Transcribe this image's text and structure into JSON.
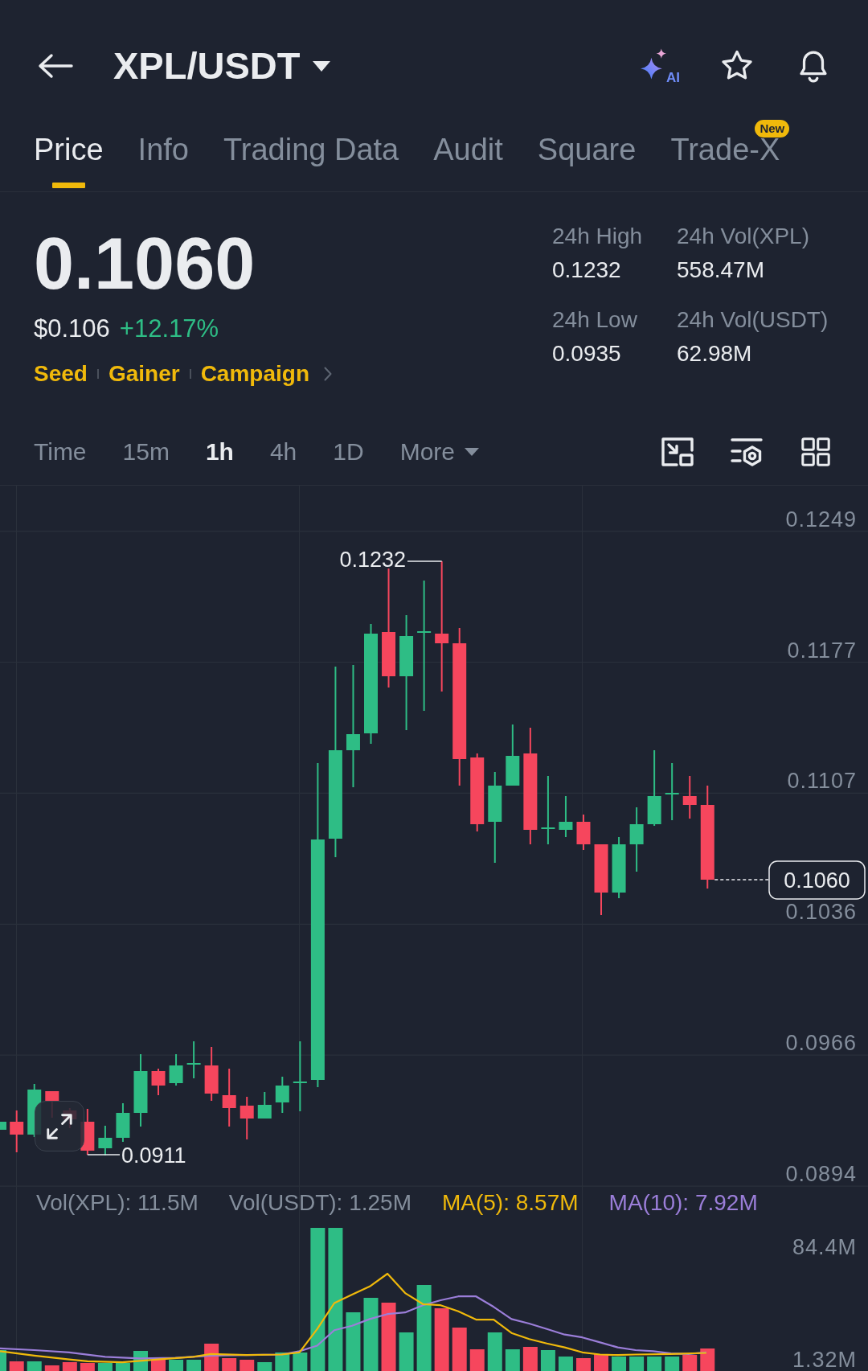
{
  "header": {
    "title": "XPL/USDT",
    "ai_label": "AI",
    "favorite": false
  },
  "tabs": [
    {
      "label": "Price",
      "selected": true
    },
    {
      "label": "Info",
      "selected": false
    },
    {
      "label": "Trading Data",
      "selected": false
    },
    {
      "label": "Audit",
      "selected": false
    },
    {
      "label": "Square",
      "selected": false
    },
    {
      "label": "Trade-X",
      "selected": false,
      "badge": "New"
    }
  ],
  "ticker": {
    "last_price": "0.1060",
    "fiat_price": "$0.106",
    "change": "+12.17%",
    "tags": [
      "Seed",
      "Gainer",
      "Campaign"
    ],
    "stats": [
      {
        "label": "24h High",
        "value": "0.1232"
      },
      {
        "label": "24h Vol(XPL)",
        "value": "558.47M"
      },
      {
        "label": "24h Low",
        "value": "0.0935"
      },
      {
        "label": "24h Vol(USDT)",
        "value": "62.98M"
      }
    ]
  },
  "intervals": [
    {
      "label": "Time",
      "selected": false,
      "kind": "option"
    },
    {
      "label": "15m",
      "selected": false,
      "kind": "option"
    },
    {
      "label": "1h",
      "selected": true,
      "kind": "option"
    },
    {
      "label": "4h",
      "selected": false,
      "kind": "option"
    },
    {
      "label": "1D",
      "selected": false,
      "kind": "option"
    },
    {
      "label": "More",
      "selected": false,
      "kind": "menu"
    }
  ],
  "chart": {
    "price_axis": [
      "0.1249",
      "0.1177",
      "0.1107",
      "0.1036",
      "0.0966",
      "0.0894"
    ],
    "high_label": "0.1232",
    "low_label": "0.0911",
    "last_price_tag": "0.1060"
  },
  "volume": {
    "legend": [
      {
        "text": "Vol(XPL): 11.5M",
        "color": "#848e9c"
      },
      {
        "text": "Vol(USDT): 1.25M",
        "color": "#848e9c"
      },
      {
        "text": "MA(5): 8.57M",
        "color": "#f0b90b"
      },
      {
        "text": "MA(10): 7.92M",
        "color": "#9b7ed9"
      }
    ],
    "axis": [
      "84.4M",
      "1.32M"
    ]
  }
}
